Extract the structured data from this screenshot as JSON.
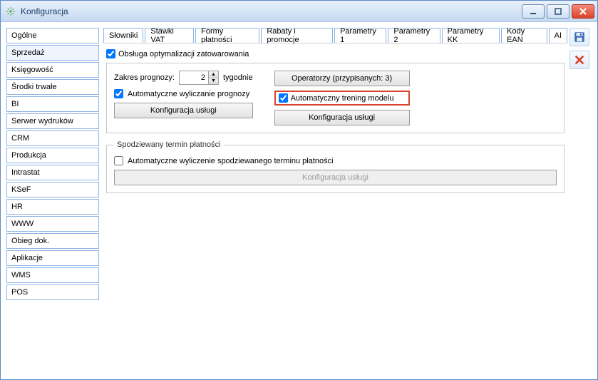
{
  "window": {
    "title": "Konfiguracja"
  },
  "icons": {
    "app": "gear-icon",
    "minimize": "minimize-icon",
    "maximize": "maximize-icon",
    "close": "close-icon",
    "save": "save-icon",
    "cancel": "cancel-icon"
  },
  "sidebar": {
    "items": [
      {
        "label": "Ogólne",
        "active": false
      },
      {
        "label": "Sprzedaż",
        "active": true
      },
      {
        "label": "Księgowość",
        "active": false
      },
      {
        "label": "Środki trwałe",
        "active": false
      },
      {
        "label": "BI",
        "active": false
      },
      {
        "label": "Serwer wydruków",
        "active": false
      },
      {
        "label": "CRM",
        "active": false
      },
      {
        "label": "Produkcja",
        "active": false
      },
      {
        "label": "Intrastat",
        "active": false
      },
      {
        "label": "KSeF",
        "active": false
      },
      {
        "label": "HR",
        "active": false
      },
      {
        "label": "WWW",
        "active": false
      },
      {
        "label": "Obieg dok.",
        "active": false
      },
      {
        "label": "Aplikacje",
        "active": false
      },
      {
        "label": "WMS",
        "active": false
      },
      {
        "label": "POS",
        "active": false
      }
    ]
  },
  "tabs": [
    {
      "label": "Słowniki",
      "active": false
    },
    {
      "label": "Stawki VAT",
      "active": false
    },
    {
      "label": "Formy płatności",
      "active": false
    },
    {
      "label": "Rabaty i promocje",
      "active": false
    },
    {
      "label": "Parametry 1",
      "active": false
    },
    {
      "label": "Parametry 2",
      "active": false
    },
    {
      "label": "Parametry KK",
      "active": false
    },
    {
      "label": "Kody EAN",
      "active": false
    },
    {
      "label": "AI",
      "active": true
    }
  ],
  "panel": {
    "check_stock_opt": {
      "checked": true,
      "label": "Obsługa optymalizacji zatowarowania"
    },
    "forecast_range_label": "Zakres prognozy:",
    "forecast_value": "2",
    "forecast_unit": "tygodnie",
    "auto_forecast": {
      "checked": true,
      "label": "Automatyczne wyliczanie prognozy"
    },
    "config_service_btn": "Konfiguracja usługi",
    "operators_btn": "Operatorzy (przypisanych: 3)",
    "auto_training": {
      "checked": true,
      "label": "Automatyczny trening modelu"
    },
    "config_service_btn2": "Konfiguracja usługi",
    "group_payment_title": "Spodziewany termin płatności",
    "auto_payment": {
      "checked": false,
      "label": "Automatyczne wyliczenie spodziewanego terminu płatności"
    },
    "config_service_btn3": "Konfiguracja usługi"
  },
  "colors": {
    "accent_blue": "#5a8ac6",
    "highlight_red": "#d9432b"
  }
}
